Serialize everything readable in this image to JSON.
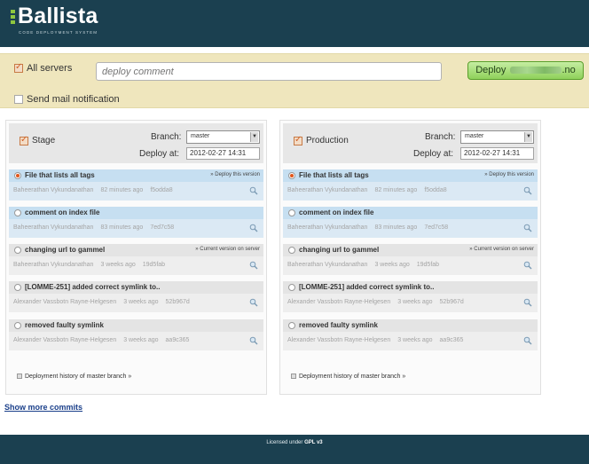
{
  "header": {
    "logo_text": "Ballista",
    "logo_subtitle": "CODE DEPLOYMENT SYSTEM"
  },
  "deploy_bar": {
    "all_servers_label": "All servers",
    "all_servers_checked": true,
    "comment_placeholder": "deploy comment",
    "deploy_prefix": "Deploy",
    "deploy_suffix": ".no",
    "send_mail_label": "Send mail notification",
    "send_mail_checked": false
  },
  "panels": [
    {
      "env_label": "Stage",
      "checked": true,
      "branch_label": "Branch:",
      "branch_value": "master",
      "deploy_at_label": "Deploy at:",
      "deploy_at_value": "2012-02-27 14:31",
      "history_link": "Deployment history of master branch",
      "commits": [
        {
          "title": "File that lists all tags",
          "action": "» Deploy this version",
          "author": "Baheerathan Vykundanathan",
          "time": "82 minutes ago",
          "hash": "f5odda8",
          "selected": true
        },
        {
          "title": "comment on index file",
          "action": "",
          "author": "Baheerathan Vykundanathan",
          "time": "83 minutes ago",
          "hash": "7ed7c58",
          "selected": false
        },
        {
          "title": "changing url to gammel",
          "action": "» Current version on server",
          "author": "Baheerathan Vykundanathan",
          "time": "3 weeks ago",
          "hash": "19d5fab",
          "selected": false
        },
        {
          "title": "[LOMME-251] added correct symlink to..",
          "action": "",
          "author": "Alexander Vassbotn Rayne-Helgesen",
          "time": "3 weeks ago",
          "hash": "52b967d",
          "selected": false
        },
        {
          "title": "removed faulty symlink",
          "action": "",
          "author": "Alexander Vassbotn Rayne-Helgesen",
          "time": "3 weeks ago",
          "hash": "aa9c365",
          "selected": false
        }
      ]
    },
    {
      "env_label": "Production",
      "checked": true,
      "branch_label": "Branch:",
      "branch_value": "master",
      "deploy_at_label": "Deploy at:",
      "deploy_at_value": "2012-02-27 14:31",
      "history_link": "Deployment history of master branch",
      "commits": [
        {
          "title": "File that lists all tags",
          "action": "» Deploy this version",
          "author": "Baheerathan Vykundanathan",
          "time": "82 minutes ago",
          "hash": "f5odda8",
          "selected": true
        },
        {
          "title": "comment on index file",
          "action": "",
          "author": "Baheerathan Vykundanathan",
          "time": "83 minutes ago",
          "hash": "7ed7c58",
          "selected": false
        },
        {
          "title": "changing url to gammel",
          "action": "» Current version on server",
          "author": "Baheerathan Vykundanathan",
          "time": "3 weeks ago",
          "hash": "19d5fab",
          "selected": false
        },
        {
          "title": "[LOMME-251] added correct symlink to..",
          "action": "",
          "author": "Alexander Vassbotn Rayne-Helgesen",
          "time": "3 weeks ago",
          "hash": "52b967d",
          "selected": false
        },
        {
          "title": "removed faulty symlink",
          "action": "",
          "author": "Alexander Vassbotn Rayne-Helgesen",
          "time": "3 weeks ago",
          "hash": "aa9c365",
          "selected": false
        }
      ]
    }
  ],
  "show_more_label": "Show more commits",
  "footer": {
    "license_prefix": "Licensed under",
    "license_name": "GPL v3"
  },
  "colors": {
    "header_bg": "#1b4050",
    "deploy_bar_bg": "#efe6bd",
    "deploy_button": "#8fd15a",
    "selected_commit": "#c6dff1",
    "accent_orange": "#e1561b",
    "link": "#1a3f8a"
  },
  "icons": {
    "commit_detail": "magnifier-icon",
    "history": "history-icon"
  }
}
